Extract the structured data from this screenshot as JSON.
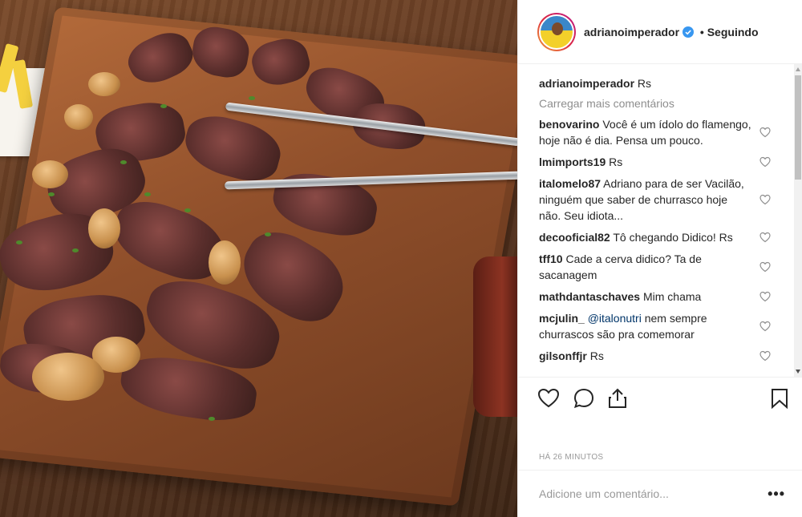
{
  "post": {
    "author": "adrianoimperador",
    "follow_status": "Seguindo",
    "caption_user": "adrianoimperador",
    "caption_text": "Rs",
    "load_more": "Carregar mais comentários",
    "timestamp": "HÁ 26 MINUTOS",
    "add_comment_placeholder": "Adicione um comentário...",
    "more_options": "•••"
  },
  "comments": [
    {
      "user": "benovarino",
      "text": "Você é um ídolo do flamengo, hoje não é dia. Pensa um pouco."
    },
    {
      "user": "lmimports19",
      "text": "Rs"
    },
    {
      "user": "italomelo87",
      "text": "Adriano para de ser Vacilão, ninguém que saber de churrasco hoje não. Seu idiota..."
    },
    {
      "user": "decooficial82",
      "text": "Tô chegando Didico! Rs"
    },
    {
      "user": "tff10",
      "text": "Cade a cerva didico? Ta de sacanagem"
    },
    {
      "user": "mathdantaschaves",
      "text": "Mim chama"
    },
    {
      "user": "mcjulin_",
      "mention": "@italonutri",
      "text": "nem sempre churrascos são pra comemorar"
    },
    {
      "user": "gilsonffjr",
      "text": "Rs"
    }
  ],
  "icons": {
    "verified": "verified-badge-icon",
    "like": "heart-icon",
    "comment": "comment-bubble-icon",
    "share": "share-icon",
    "save": "bookmark-icon",
    "options": "more-options-icon"
  },
  "colors": {
    "verified_blue": "#3897f0",
    "text": "#262626",
    "muted": "#8e8e8e",
    "mention": "#003569"
  }
}
